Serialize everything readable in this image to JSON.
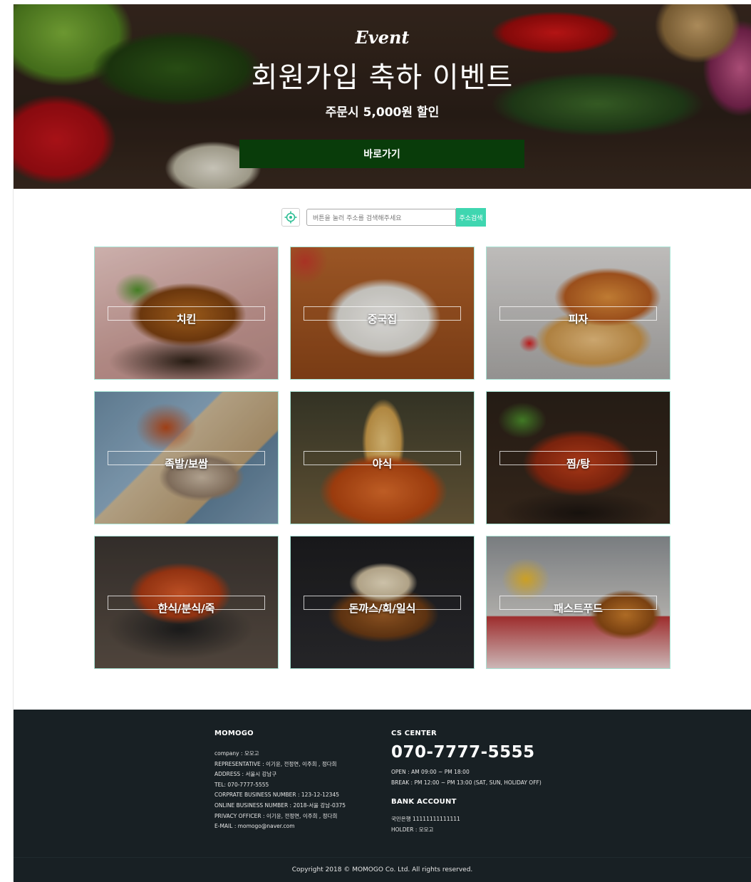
{
  "hero": {
    "event_label": "Event",
    "title": "회원가입 축하 이벤트",
    "subtitle": "주문시 5,000원 할인",
    "button_label": "바로가기",
    "button_color": "#093c0a"
  },
  "search": {
    "placeholder": "버튼을 눌러 주소를 검색해주세요",
    "button_label": "주소검색",
    "location_icon": "location-target-icon",
    "accent_color": "#3fd6b0"
  },
  "categories": [
    {
      "label": "치킨"
    },
    {
      "label": "중국집"
    },
    {
      "label": "피자"
    },
    {
      "label": "족발/보쌈"
    },
    {
      "label": "야식"
    },
    {
      "label": "찜/탕"
    },
    {
      "label": "한식/분식/죽"
    },
    {
      "label": "돈까스/회/일식"
    },
    {
      "label": "패스트푸드"
    }
  ],
  "footer": {
    "company_title": "MOMOGO",
    "company_lines": [
      "company : 모모고",
      "REPRESENTATIVE : 이기윤, 전정연, 이주희 , 정다희",
      "ADDRESS : 서울시 강남구",
      "TEL: 070-7777-5555",
      "CORPRATE BUSINESS NUMBER : 123-12-12345",
      "ONLINE BUSINESS NUMBER : 2018-서울 강남-0375",
      "PRIVACY OFFICER : 이기윤, 전정연, 이주희 , 정다희",
      "E-MAIL : momogo@naver.com"
    ],
    "cs_title": "CS CENTER",
    "cs_phone": "070-7777-5555",
    "cs_hours": [
      "OPEN : AM 09:00 ~ PM 18:00",
      "BREAK : PM 12:00 ~ PM 13:00 (SAT, SUN, HOLIDAY OFF)"
    ],
    "bank_title": "BANK ACCOUNT",
    "bank_lines": [
      "국민은행 11111111111111",
      "HOLDER : 모모고"
    ],
    "background_color": "#182024"
  },
  "copyright": "Copyright 2018 © MOMOGO Co. Ltd. All rights reserved."
}
